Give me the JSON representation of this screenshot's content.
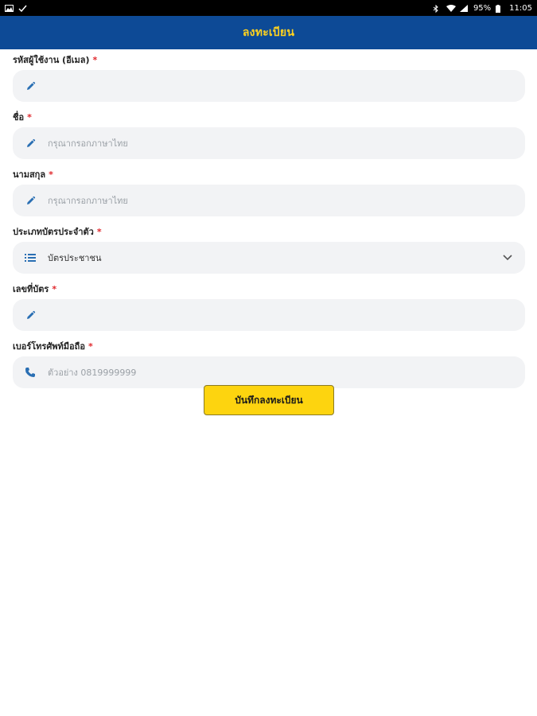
{
  "status_bar": {
    "time": "11:05",
    "battery": "95%"
  },
  "app_bar": {
    "title": "ลงทะเบียน"
  },
  "form": {
    "required_mark": "*",
    "fields": [
      {
        "label": "รหัสผู้ใช้งาน (อีเมล)",
        "placeholder": "",
        "value": "",
        "icon": "pencil-icon"
      },
      {
        "label": "ชื่อ",
        "placeholder": "กรุณากรอกภาษาไทย",
        "value": "",
        "icon": "pencil-icon"
      },
      {
        "label": "นามสกุล",
        "placeholder": "กรุณากรอกภาษาไทย",
        "value": "",
        "icon": "pencil-icon"
      },
      {
        "label": "ประเภทบัตรประจำตัว",
        "placeholder": "",
        "value": "บัตรประชาชน",
        "icon": "list-icon"
      },
      {
        "label": "เลขที่บัตร",
        "placeholder": "",
        "value": "",
        "icon": "pencil-icon"
      },
      {
        "label": "เบอร์โทรศัพท์มือถือ",
        "placeholder": "ตัวอย่าง 0819999999",
        "value": "",
        "icon": "phone-icon"
      }
    ],
    "submit_label": "บันทึกลงทะเบียน"
  },
  "colors": {
    "app_bar": "#0d4a96",
    "title": "#ffd21f",
    "field_bg": "#f2f3f5",
    "icon": "#2a6fb3",
    "required": "#e0282d",
    "button": "#fdd40f"
  }
}
